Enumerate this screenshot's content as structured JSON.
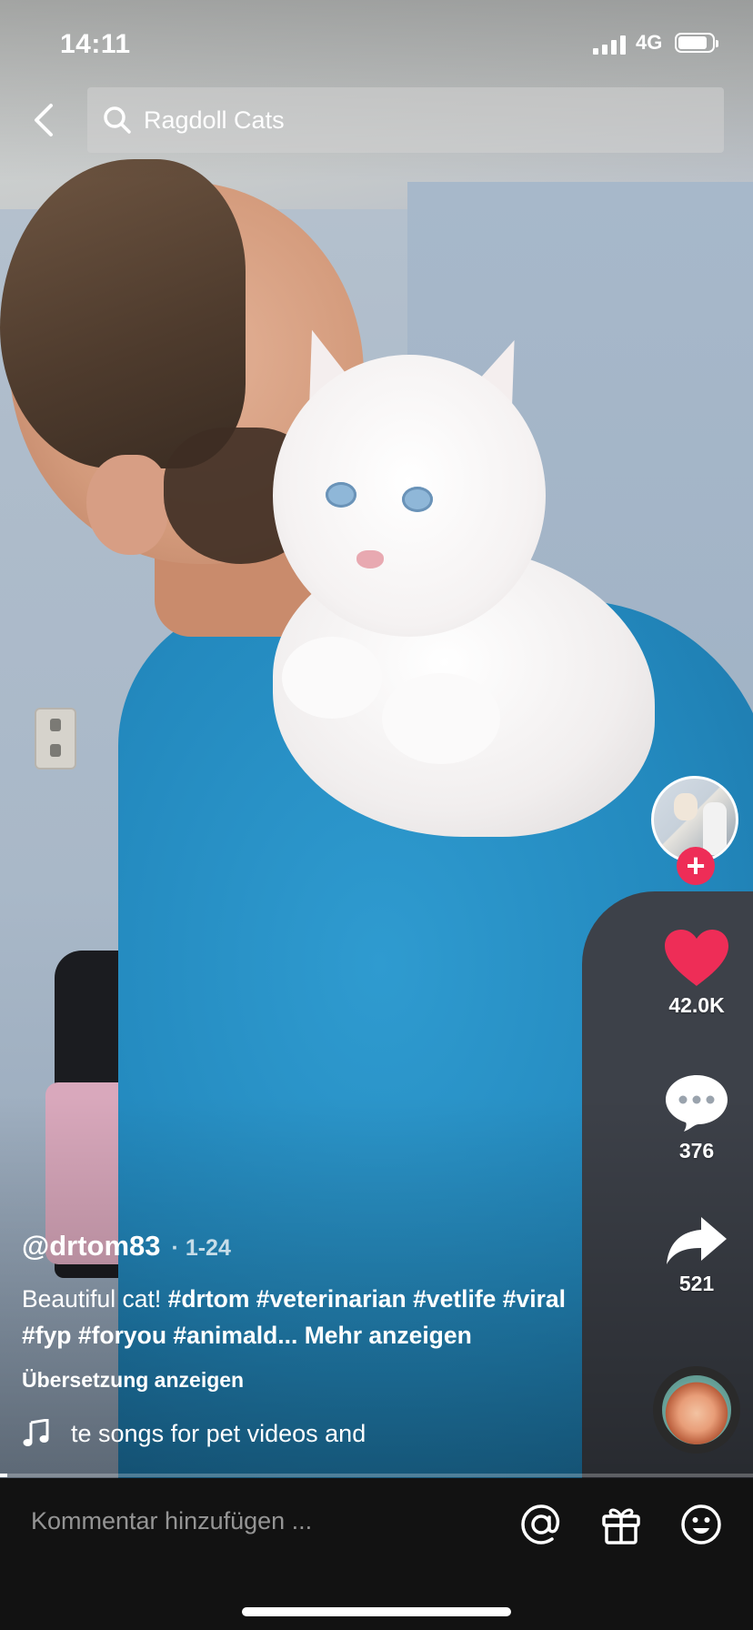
{
  "status_bar": {
    "time": "14:11",
    "network": "4G"
  },
  "search": {
    "query": "Ragdoll Cats"
  },
  "video": {
    "progress_fraction": 0.01
  },
  "creator": {
    "handle": "@drtom83",
    "date": "· 1-24"
  },
  "caption": {
    "text": "Beautiful cat! ",
    "hashtags": "#drtom #veterinarian #vetlife #viral #fyp #foryou #animald...",
    "more_label": "Mehr anzeigen",
    "translate_label": "Übersetzung anzeigen"
  },
  "music": {
    "title": "te songs for pet videos and"
  },
  "actions": {
    "likes": "42.0K",
    "comments": "376",
    "shares": "521"
  },
  "comment_bar": {
    "placeholder": "Kommentar hinzufügen ..."
  },
  "colors": {
    "like": "#ee2d57",
    "follow": "#ee2d57",
    "bottom_bar": "#121212"
  }
}
